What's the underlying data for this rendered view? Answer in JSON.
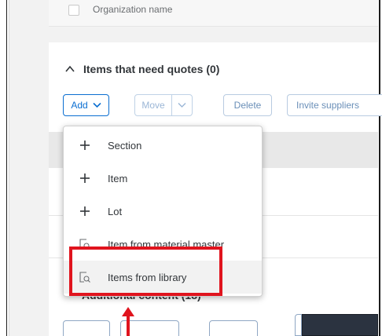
{
  "top_row": {
    "label": "Organization name"
  },
  "section": {
    "title": "Items that need quotes (0)"
  },
  "toolbar": {
    "add_label": "Add",
    "move_label": "Move",
    "delete_label": "Delete",
    "invite_label": "Invite suppliers"
  },
  "add_menu": {
    "items": [
      {
        "label": "Section",
        "icon": "plus-icon"
      },
      {
        "label": "Item",
        "icon": "plus-icon"
      },
      {
        "label": "Lot",
        "icon": "plus-icon"
      },
      {
        "label": "Item from material master",
        "icon": "search-document-icon"
      },
      {
        "label": "Items from library",
        "icon": "search-document-icon"
      }
    ]
  },
  "next_section": {
    "title": "Additional content (18)"
  },
  "colors": {
    "accent": "#0a6ed1",
    "highlight": "#e0141e",
    "text": "#32363a",
    "dark_box": "#2b3340"
  }
}
